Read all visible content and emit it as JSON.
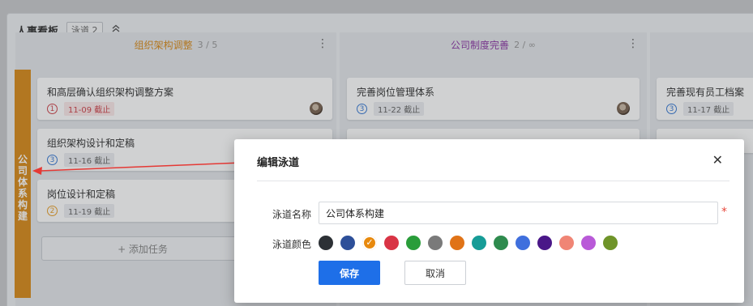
{
  "board": {
    "title": "人事看板",
    "lane_badge": "泳道 2",
    "collapse_icon": "double-chevron-up-icon"
  },
  "columns": [
    {
      "name": "组织架构调整",
      "count": "3 / 5",
      "color": "#d98c1d",
      "cards": [
        {
          "title": "和高层确认组织架构调整方案",
          "priority": "1",
          "priority_color": "#d0454c",
          "due": "11-09 截止",
          "overdue": true,
          "has_avatar": true
        },
        {
          "title": "组织架构设计和定稿",
          "priority": "3",
          "priority_color": "#3a7bd5",
          "due": "11-16 截止",
          "overdue": false,
          "has_avatar": false
        },
        {
          "title": "岗位设计和定稿",
          "priority": "2",
          "priority_color": "#e8a02c",
          "due": "11-19 截止",
          "overdue": false,
          "has_avatar": false
        }
      ],
      "add_task": "+ 添加任务"
    },
    {
      "name": "公司制度完善",
      "count": "2 / ∞",
      "color": "#8e3aa6",
      "cards": [
        {
          "title": "完善岗位管理体系",
          "priority": "3",
          "priority_color": "#3a7bd5",
          "due": "11-22 截止",
          "overdue": false,
          "has_avatar": true
        }
      ]
    },
    {
      "name": "",
      "count": "",
      "cards": [
        {
          "title": "完善现有员工档案",
          "priority": "3",
          "priority_color": "#3a7bd5",
          "due": "11-17 截止",
          "overdue": false,
          "has_avatar": true
        }
      ]
    }
  ],
  "swimlane": {
    "label": "公司体系构建",
    "color": "#d98c1d"
  },
  "dialog": {
    "title": "编辑泳道",
    "close_icon": "close-icon",
    "name_label": "泳道名称",
    "name_value": "公司体系构建",
    "required_mark": "*",
    "color_label": "泳道颜色",
    "colors": [
      "#2c3035",
      "#2d4f99",
      "#e8890c",
      "#d93445",
      "#2a9d3a",
      "#7a7a7a",
      "#e07317",
      "#169c97",
      "#2e8b4e",
      "#3f6fdd",
      "#4a1788",
      "#f08575",
      "#b95ad8",
      "#6f9429"
    ],
    "selected_color_index": 2,
    "save_label": "保存",
    "cancel_label": "取消"
  }
}
